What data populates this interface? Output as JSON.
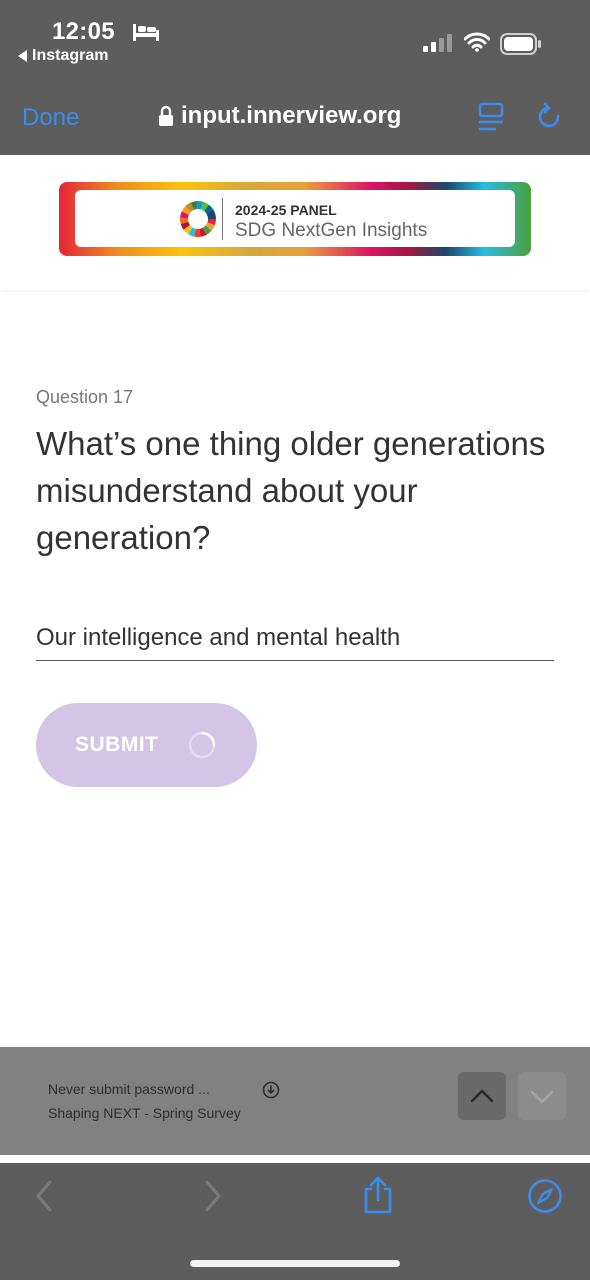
{
  "status_bar": {
    "time": "12:05",
    "back_app": "Instagram",
    "icons": [
      "bed-icon",
      "signal-icon",
      "wifi-icon",
      "battery-icon"
    ]
  },
  "browser": {
    "done_label": "Done",
    "url": "input.innerview.org",
    "icons": [
      "lock-icon",
      "reader-icon",
      "reload-icon"
    ],
    "accent_color": "#3c8cf0"
  },
  "banner": {
    "panel": "2024-25 PANEL",
    "title": "SDG NextGen Insights"
  },
  "question": {
    "number_label": "Question 17",
    "text": "What’s one thing older generations misunderstand about your generation?",
    "answer_value": "Our intelligence and mental health"
  },
  "submit": {
    "label": "SUBMIT",
    "color": "#d3c5e5"
  },
  "accessory": {
    "line1": "Never submit password   ...",
    "line2": "Shaping NEXT - Spring Survey"
  },
  "toolbar": {
    "icons": [
      "back-chevron-icon",
      "forward-chevron-icon",
      "share-icon",
      "safari-compass-icon"
    ]
  }
}
